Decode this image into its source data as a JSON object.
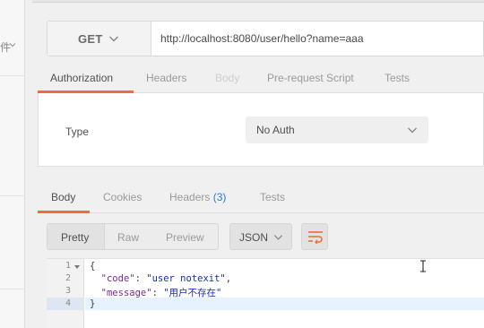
{
  "request": {
    "method": "GET",
    "url": "http://localhost:8080/user/hello?name=aaa"
  },
  "request_tabs": [
    {
      "label": "Authorization",
      "state": "active"
    },
    {
      "label": "Headers",
      "state": "normal"
    },
    {
      "label": "Body",
      "state": "disabled"
    },
    {
      "label": "Pre-request Script",
      "state": "normal"
    },
    {
      "label": "Tests",
      "state": "normal"
    }
  ],
  "auth": {
    "type_label": "Type",
    "selected": "No Auth"
  },
  "response_tabs": [
    {
      "label": "Body",
      "state": "active"
    },
    {
      "label": "Cookies",
      "state": "normal"
    },
    {
      "label": "Headers",
      "count": "(3)",
      "state": "normal"
    },
    {
      "label": "Tests",
      "state": "normal"
    }
  ],
  "view_modes": [
    "Pretty",
    "Raw",
    "Preview"
  ],
  "active_view_mode": "Pretty",
  "format": "JSON",
  "editor": {
    "line_numbers": [
      "1",
      "2",
      "3",
      "4"
    ],
    "highlighted_line": 4,
    "lines": {
      "l1": "{",
      "l2_key": "\"code\"",
      "l2_sep": ": ",
      "l2_val": "\"user notexit\"",
      "l2_end": ",",
      "l3_key": "\"message\"",
      "l3_sep": ": ",
      "l3_val": "\"用户不存在\"",
      "l4": "}"
    }
  },
  "sidebar": {
    "fragment": "件"
  },
  "colors": {
    "accent": "#f26b3a",
    "badge": "#2b7bd6",
    "json_key": "#7c2b8f",
    "json_string": "#1a2fb0"
  }
}
